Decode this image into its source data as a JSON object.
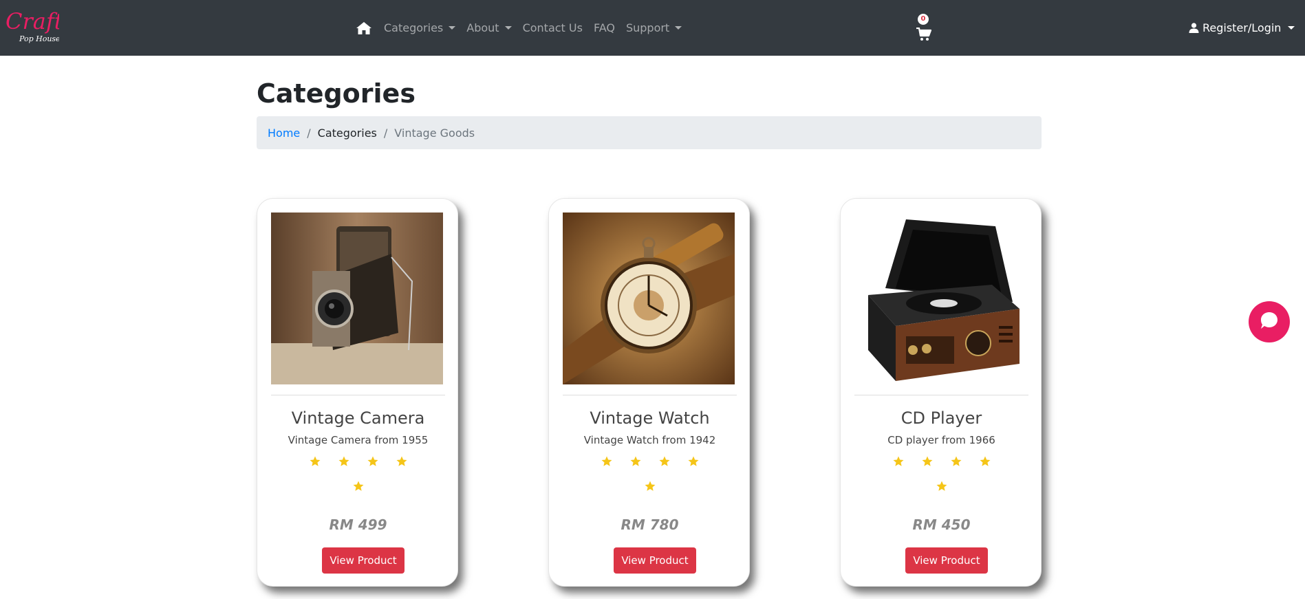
{
  "brand": {
    "name_line1": "Craft",
    "name_line2": "Pop House",
    "accent_color": "#e91e63"
  },
  "nav": {
    "home_icon": "home-icon",
    "items": [
      {
        "label": "Categories",
        "dropdown": true
      },
      {
        "label": "About",
        "dropdown": true
      },
      {
        "label": "Contact Us",
        "dropdown": false
      },
      {
        "label": "FAQ",
        "dropdown": false
      },
      {
        "label": "Support",
        "dropdown": true
      }
    ],
    "cart_count": "0",
    "cart_icon": "cart-icon",
    "account_label": "Register/Login",
    "account_icon": "user-icon"
  },
  "page": {
    "title": "Categories",
    "breadcrumb": [
      "Home",
      "Categories",
      "Vintage Goods"
    ]
  },
  "products": [
    {
      "name": "Vintage Camera",
      "description": "Vintage Camera from 1955",
      "rating": 5,
      "price": "RM 499",
      "button": "View Product"
    },
    {
      "name": "Vintage Watch",
      "description": "Vintage Watch from 1942",
      "rating": 5,
      "price": "RM 780",
      "button": "View Product"
    },
    {
      "name": "CD Player",
      "description": "CD player from 1966",
      "rating": 5,
      "price": "RM 450",
      "button": "View Product"
    }
  ],
  "colors": {
    "navbar": "#343a40",
    "button": "#dc3545",
    "star": "#f5c518",
    "link": "#007bff"
  },
  "chat_icon": "chat-bubble-icon"
}
